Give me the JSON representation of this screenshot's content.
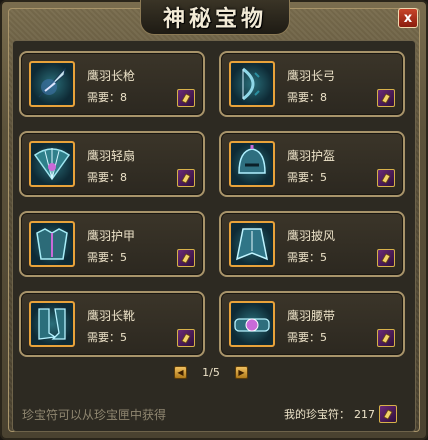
{
  "window": {
    "title": "神秘宝物",
    "close_label": "x"
  },
  "items": [
    {
      "name": "鹰羽长枪",
      "need": "需要：8",
      "icon": "spear-icon"
    },
    {
      "name": "鹰羽长弓",
      "need": "需要：8",
      "icon": "bow-icon"
    },
    {
      "name": "鹰羽轻扇",
      "need": "需要：8",
      "icon": "fan-icon"
    },
    {
      "name": "鹰羽护盔",
      "need": "需要：5",
      "icon": "helmet-icon"
    },
    {
      "name": "鹰羽护甲",
      "need": "需要：5",
      "icon": "armor-icon"
    },
    {
      "name": "鹰羽披风",
      "need": "需要：5",
      "icon": "cape-icon"
    },
    {
      "name": "鹰羽长靴",
      "need": "需要：5",
      "icon": "boots-icon"
    },
    {
      "name": "鹰羽腰带",
      "need": "需要：5",
      "icon": "belt-icon"
    }
  ],
  "pager": {
    "text": "1/5"
  },
  "footer": {
    "hint": "珍宝符可以从珍宝匣中获得",
    "balance_label": "我的珍宝符：",
    "balance_value": "217"
  },
  "colors": {
    "accent": "#e8a23a",
    "card_border": "#a8946a",
    "coupon": "#6a2a78"
  }
}
